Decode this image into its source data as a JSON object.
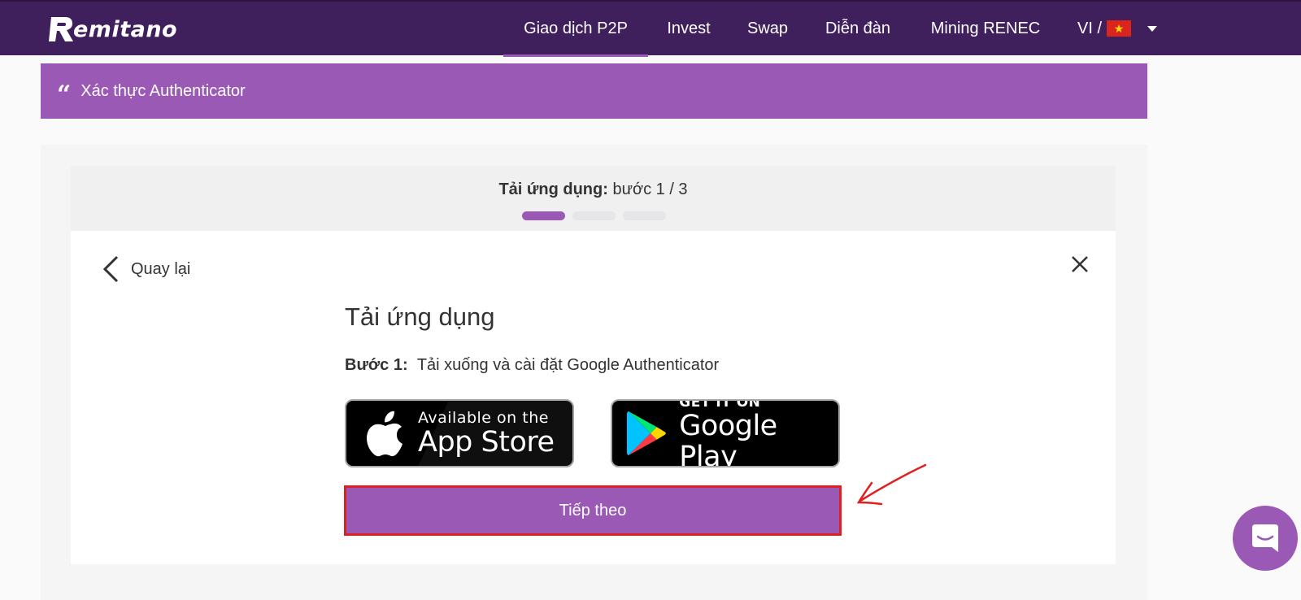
{
  "navbar": {
    "logo": "emitano",
    "items": [
      {
        "label": "Giao dịch P2P",
        "active": true
      },
      {
        "label": "Invest"
      },
      {
        "label": "Swap"
      },
      {
        "label": "Diễn đàn"
      },
      {
        "label": "Mining RENEC"
      }
    ],
    "lang": "VI /"
  },
  "banner": {
    "title": "Xác thực Authenticator"
  },
  "step_header": {
    "label": "Tải ứng dụng:",
    "value": "bước 1 / 3",
    "current_step": 1,
    "total_steps": 3
  },
  "panel": {
    "back_label": "Quay lại",
    "title": "Tải ứng dụng",
    "step_label": "Bước 1:",
    "step_text": "Tải xuống và cài đặt Google Authenticator",
    "app_store": {
      "small": "Available on the",
      "big": "App Store"
    },
    "google_play": {
      "small": "GET IT ON",
      "big": "Google Play"
    },
    "next_label": "Tiếp theo"
  },
  "colors": {
    "nav_bg": "#40205c",
    "accent": "#9b59b6",
    "highlight": "#e02020"
  }
}
